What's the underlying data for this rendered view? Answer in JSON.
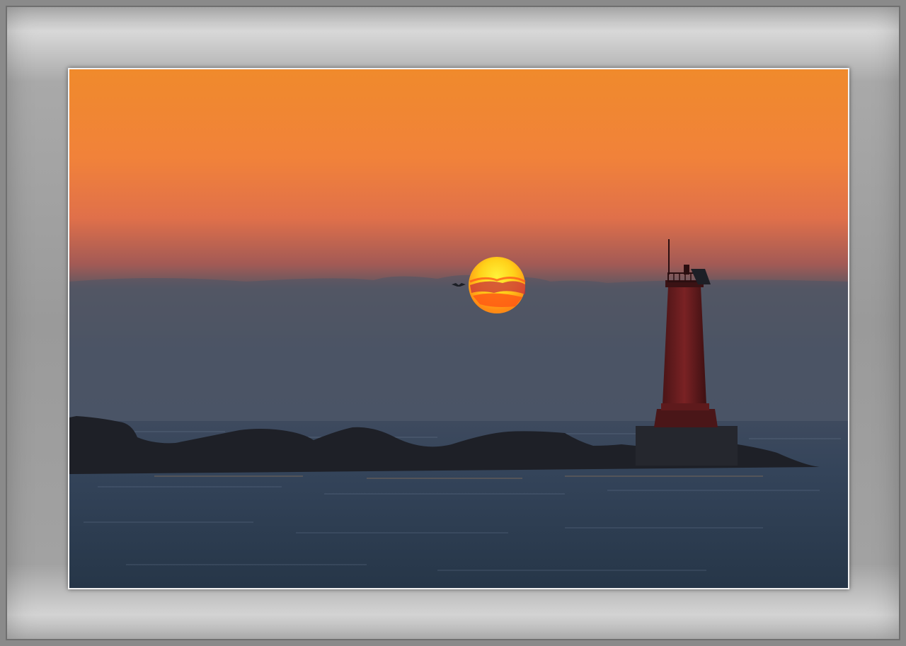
{
  "scene": {
    "subject": "lighthouse-sunset",
    "colors": {
      "sky_top": "#f08a2a",
      "sky_mid": "#e8703c",
      "haze": "#4b5566",
      "sea": "#2d3b4e",
      "sun_core": "#ffe21a",
      "sun_edge": "#ff4a12",
      "silhouette": "#1c1f26",
      "lighthouse": "#6d1c1e",
      "frame": "#9c9c9c"
    }
  }
}
